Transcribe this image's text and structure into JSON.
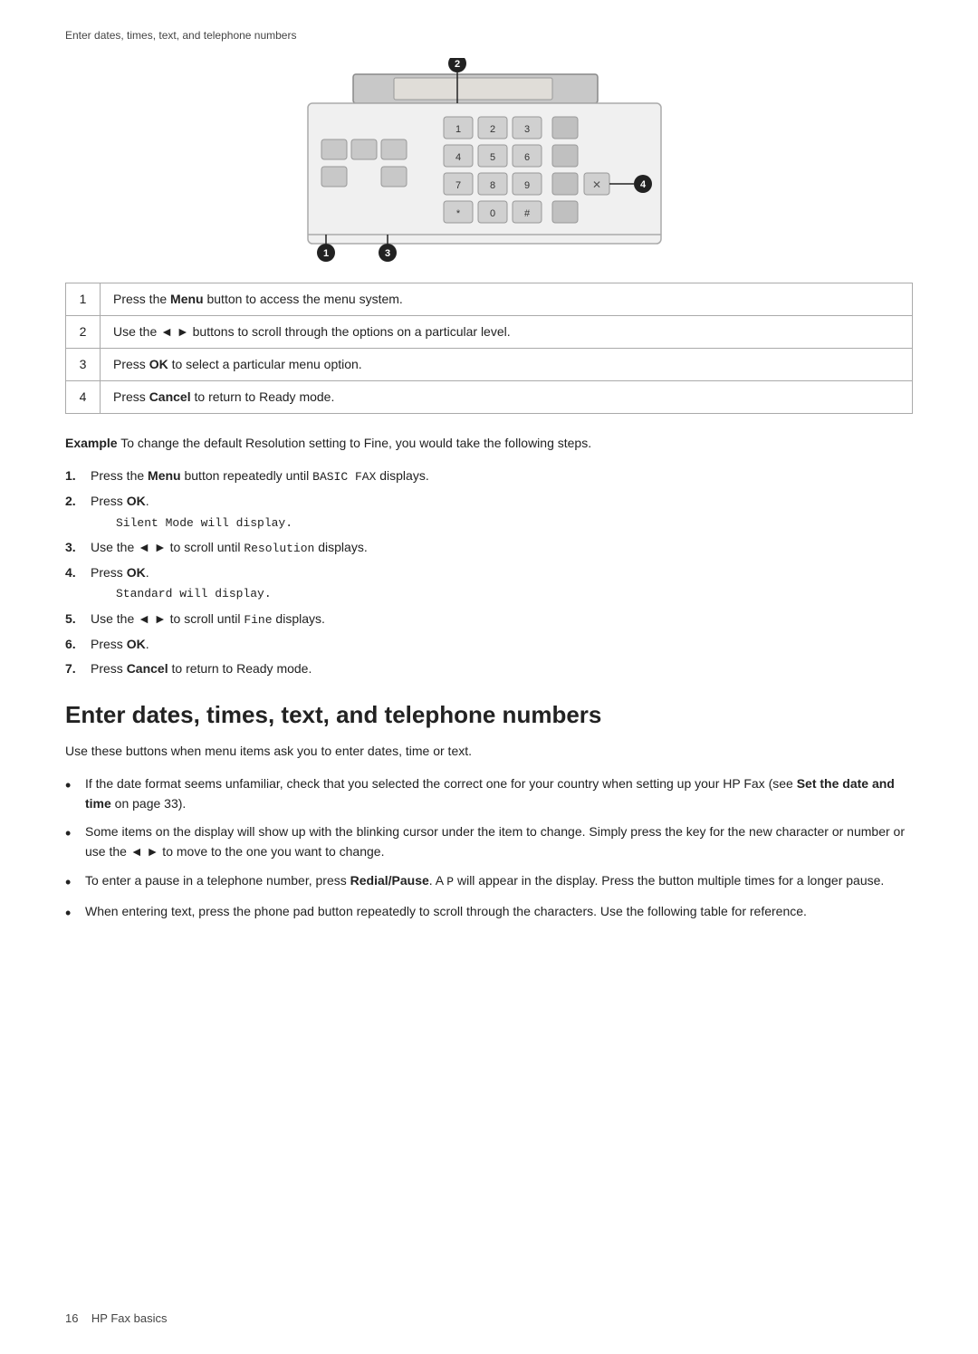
{
  "breadcrumb": "Enter dates, times, text, and telephone numbers",
  "table": {
    "rows": [
      {
        "num": "1",
        "text_before": "Press the ",
        "bold": "Menu",
        "text_after": " button to access the menu system."
      },
      {
        "num": "2",
        "text_before": "Use the ",
        "bold": "◄ ►",
        "text_after": " buttons to scroll through the options on a particular level."
      },
      {
        "num": "3",
        "text_before": "Press ",
        "bold": "OK",
        "text_after": " to select a particular menu option."
      },
      {
        "num": "4",
        "text_before": "Press ",
        "bold": "Cancel",
        "text_after": " to return to Ready mode."
      }
    ]
  },
  "example": {
    "label_bold": "Example",
    "text": " To change the default Resolution setting to Fine, you would take the following steps."
  },
  "steps": [
    {
      "num": "1.",
      "text_before": "Press the ",
      "bold": "Menu",
      "text_after": " button repeatedly until ",
      "mono": "BASIC FAX",
      "text_end": " displays."
    },
    {
      "num": "2.",
      "text_before": "Press ",
      "bold": "OK",
      "text_after": ".",
      "sub": "Silent Mode will display."
    },
    {
      "num": "3.",
      "text_before": "Use the ◄ ► to scroll until ",
      "mono": "Resolution",
      "text_end": " displays."
    },
    {
      "num": "4.",
      "text_before": "Press ",
      "bold": "OK",
      "text_after": ".",
      "sub": "Standard will display."
    },
    {
      "num": "5.",
      "text_before": "Use the ◄ ► to scroll until ",
      "mono": "Fine",
      "text_end": " displays."
    },
    {
      "num": "6.",
      "text_before": "Press ",
      "bold": "OK",
      "text_after": "."
    },
    {
      "num": "7.",
      "text_before": "Press ",
      "bold": "Cancel",
      "text_after": " to return to Ready mode."
    }
  ],
  "section_heading": "Enter dates, times, text, and telephone numbers",
  "intro": "Use these buttons when menu items ask you to enter dates, time or text.",
  "bullets": [
    "If the date format seems unfamiliar, check that you selected the correct one for your country when setting up your HP Fax (see <b>Set the date and time</b> on page 33).",
    "Some items on the display will show up with the blinking cursor under the item to change. Simply press the key for the new character or number or use the ◄ ► to move to the one you want to change.",
    "To enter a pause in a telephone number, press <b>Redial/Pause</b>. A <mono>P</mono> will appear in the display. Press the button multiple times for a longer pause.",
    "When entering text, press the phone pad button repeatedly to scroll through the characters. Use the following table for reference."
  ],
  "footer": {
    "page_num": "16",
    "section": "HP Fax basics"
  },
  "callouts": [
    "❶",
    "❷",
    "❸",
    "❹"
  ]
}
